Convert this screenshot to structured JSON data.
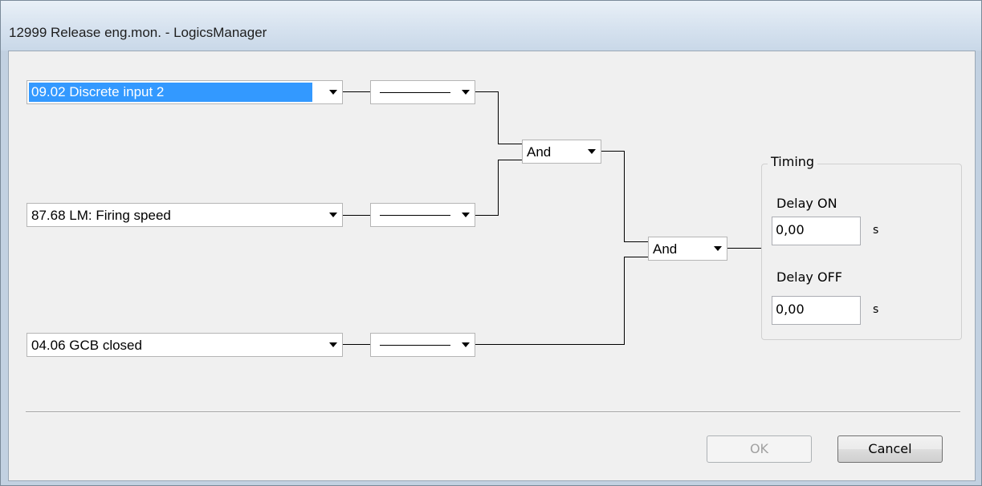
{
  "window": {
    "title": "12999 Release eng.mon. - LogicsManager"
  },
  "inputs": [
    {
      "value": "09.02 Discrete input 2"
    },
    {
      "value": "87.68 LM: Firing speed"
    },
    {
      "value": "04.06 GCB closed"
    }
  ],
  "operators": {
    "and1": "And",
    "and2": "And"
  },
  "timing": {
    "legend": "Timing",
    "delay_on_label": "Delay ON",
    "delay_on_value": "0,00",
    "delay_on_unit": "s",
    "delay_off_label": "Delay OFF",
    "delay_off_value": "0,00",
    "delay_off_unit": "s"
  },
  "buttons": {
    "ok": "OK",
    "cancel": "Cancel"
  }
}
